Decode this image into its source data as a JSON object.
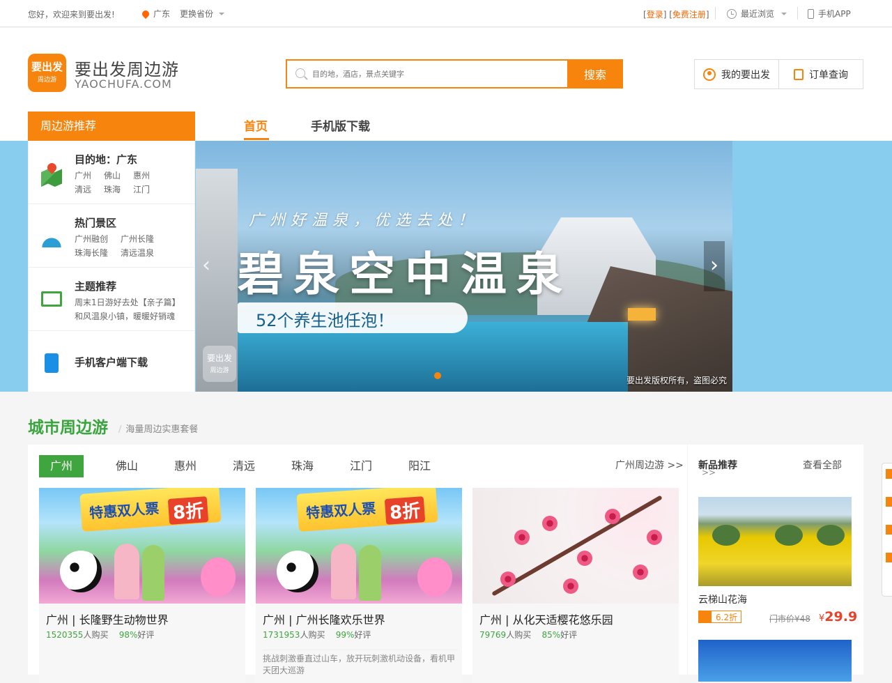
{
  "topbar": {
    "welcome": "您好，欢迎来到要出发!",
    "location": "广东",
    "change_province": "更换省份",
    "login": "登录",
    "register": "免费注册",
    "recent": "最近浏览",
    "mobile_app": "手机APP"
  },
  "header": {
    "logo_line1": "要出发",
    "logo_line2": "周边游",
    "brand_cn": "要出发周边游",
    "brand_en": "YAOCHUFA.COM",
    "search_placeholder": "目的地，酒店，景点关键字",
    "search_button": "搜索",
    "my_account": "我的要出发",
    "order_query": "订单查询",
    "recommend_tab": "周边游推荐",
    "nav": [
      "首页",
      "手机版下载"
    ]
  },
  "sidemenu": [
    {
      "title": "目的地：广东",
      "links": [
        "广州",
        "佛山",
        "惠州",
        "清远",
        "珠海",
        "江门"
      ],
      "icon": "map-icon"
    },
    {
      "title": "热门景区",
      "links": [
        "广州融创",
        "广州长隆",
        "珠海长隆",
        "清远温泉"
      ],
      "icon": "island-icon"
    },
    {
      "title": "主题推荐",
      "links": [
        "周末1日游好去处【亲子篇】",
        "和风温泉小镇，暖暖好销魂"
      ],
      "icon": "book-icon"
    },
    {
      "title": "手机客户端下载",
      "links": [],
      "icon": "mobile-download-icon"
    }
  ],
  "banner": {
    "slogan": "广州好温泉，优选去处！",
    "headline": "碧泉空中温泉",
    "subline": "52个养生池任泡！",
    "watermark_logo1": "要出发",
    "watermark_logo2": "周边游",
    "copyright": "要出发版权所有，盗图必究",
    "prev": "‹",
    "next": "›"
  },
  "section": {
    "title": "城市周边游",
    "subtitle": "海量周边实惠套餐",
    "city_tabs": [
      "广州",
      "佛山",
      "惠州",
      "清远",
      "珠海",
      "江门",
      "阳江"
    ],
    "more": "广州周边游 >>"
  },
  "cards": [
    {
      "banner_text": "特惠双人票",
      "discount_badge": "8折",
      "title": "广州 | 长隆野生动物世界",
      "buyers": "1520355",
      "buyers_suffix": "人购买",
      "rating": "98%",
      "rating_suffix": "好评",
      "desc": ""
    },
    {
      "banner_text": "特惠双人票",
      "discount_badge": "8折",
      "title": "广州 | 广州长隆欢乐世界",
      "buyers": "1731953",
      "buyers_suffix": "人购买",
      "rating": "99%",
      "rating_suffix": "好评",
      "desc": "挑战刺激垂直过山车，放开玩刺激机动设备，看机甲天团大巡游"
    },
    {
      "title": "广州 | 从化天适樱花悠乐园",
      "buyers": "79769",
      "buyers_suffix": "人购买",
      "rating": "85%",
      "rating_suffix": "好评",
      "desc": ""
    }
  ],
  "new_products": {
    "title": "新品推荐",
    "more": "查看全部",
    "more_arrow": ">>",
    "item": {
      "name": "云梯山花海",
      "discount": "6.2折",
      "original": "门市价¥48",
      "currency": "¥",
      "price": "29.9"
    }
  },
  "colors": {
    "accent": "#f7840c",
    "green": "#3fa53f",
    "price": "#e8432a",
    "banner_bg": "#88ccee"
  }
}
